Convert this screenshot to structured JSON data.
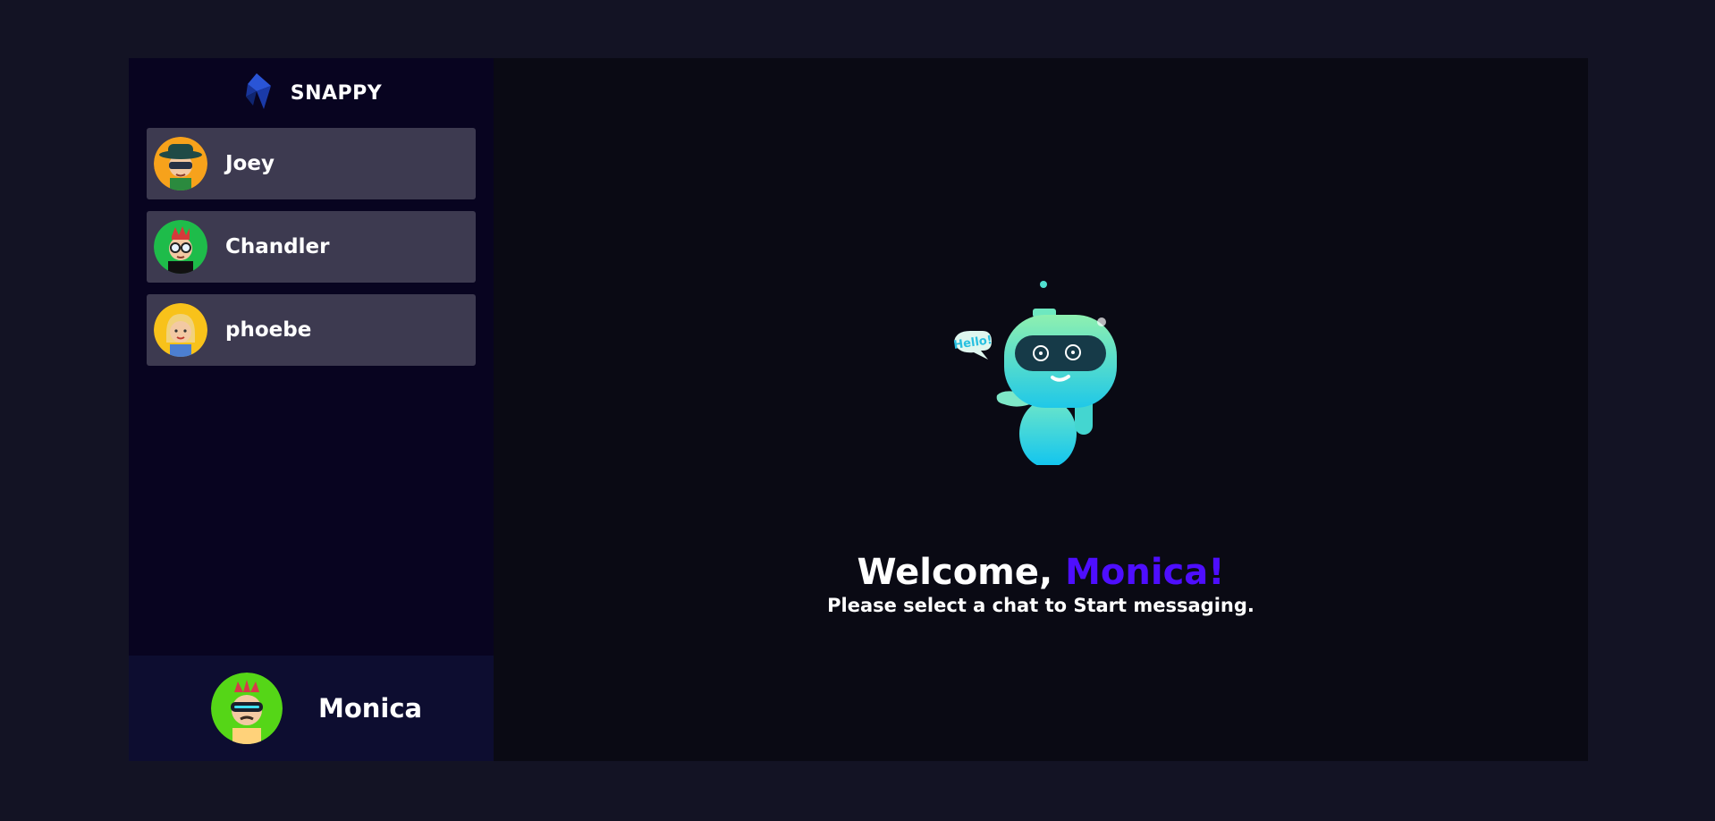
{
  "brand": {
    "name": "SNAPPY",
    "logo_icon": "snappy-logo-icon"
  },
  "contacts": [
    {
      "name": "Joey",
      "avatar": "avatar-joey-icon",
      "avatar_bg": "#f7a21b"
    },
    {
      "name": "Chandler",
      "avatar": "avatar-chandler-icon",
      "avatar_bg": "#1ebc4a"
    },
    {
      "name": "phoebe",
      "avatar": "avatar-phoebe-icon",
      "avatar_bg": "#f8c21a"
    }
  ],
  "current_user": {
    "name": "Monica",
    "avatar": "avatar-monica-icon",
    "avatar_bg": "#55d617"
  },
  "welcome": {
    "greeting": "Welcome,",
    "username": "Monica!",
    "subtitle": "Please select a chat to Start messaging.",
    "robot_bubble": "Hello!"
  },
  "colors": {
    "page_bg": "#131324",
    "sidebar_bg": "#080420",
    "contact_bg": "#3d3a50",
    "current_user_bg": "#0d0d30",
    "accent": "#4e0eff"
  }
}
